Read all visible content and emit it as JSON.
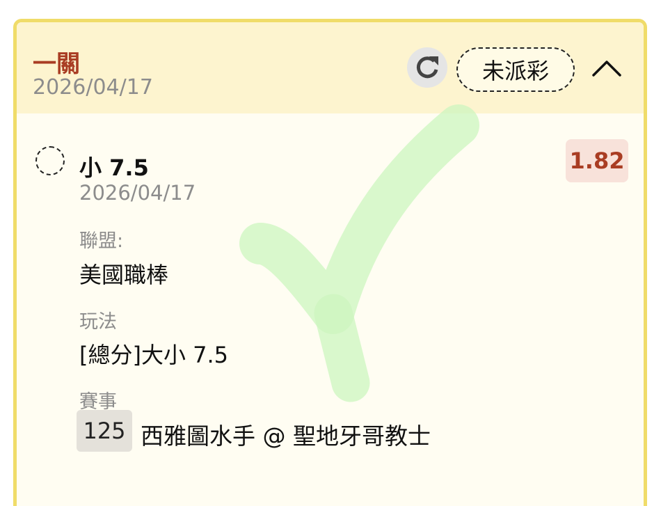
{
  "header": {
    "bet_type": "一關",
    "date": "2026/04/17",
    "status": "未派彩"
  },
  "icons": {
    "refresh": "refresh-icon",
    "collapse": "chevron-up-icon",
    "watermark": "check-icon"
  },
  "selection": {
    "name": "小 7.5",
    "date": "2026/04/17",
    "odds": "1.82"
  },
  "details": {
    "league_label": "聯盟:",
    "league_value": "美國職棒",
    "play_label": "玩法",
    "play_value": "[總分]大小 7.5",
    "event_label": "賽事",
    "event_number": "125",
    "event_teams": "西雅圖水手 @ 聖地牙哥教士"
  },
  "colors": {
    "accent": "#a93d23",
    "header_bg": "#fdf4cf",
    "border": "#f0dc69",
    "check_watermark": "#ccf5bf"
  }
}
